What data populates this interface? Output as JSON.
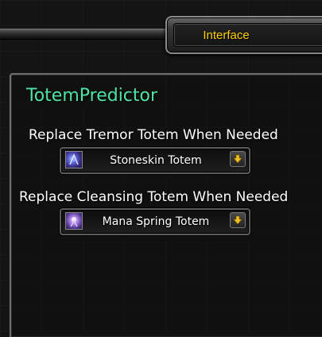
{
  "window": {
    "tab_label": "Interface"
  },
  "addon": {
    "title": "TotemPredictor"
  },
  "options": [
    {
      "label": "Replace Tremor Totem When Needed",
      "selected": "Stoneskin Totem",
      "icon": "tremor-totem-icon"
    },
    {
      "label": "Replace Cleansing Totem When Needed",
      "selected": "Mana Spring Totem",
      "icon": "mana-spring-totem-icon"
    }
  ],
  "colors": {
    "tab_text": "#ffd100",
    "addon_title": "#4fe3a8",
    "label_text": "#ffffff"
  }
}
